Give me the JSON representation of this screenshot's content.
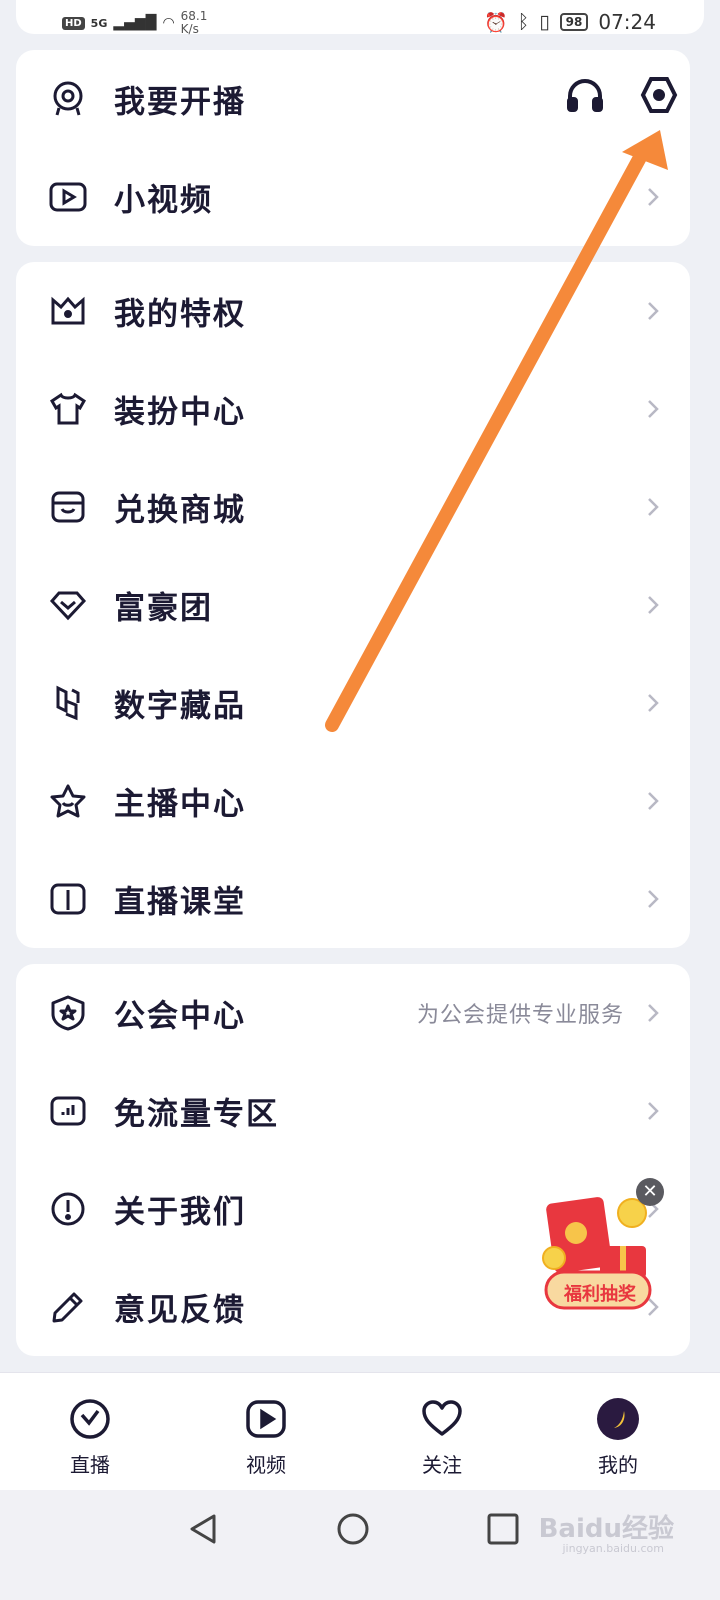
{
  "status_bar": {
    "hd": "HD",
    "network": "5G",
    "speed_value": "68.1",
    "speed_unit": "K/s",
    "battery": "98",
    "time": "07:24"
  },
  "section1": {
    "items": [
      {
        "label": "我要开播",
        "icon": "webcam-icon"
      },
      {
        "label": "小视频",
        "icon": "play-box-icon"
      }
    ],
    "header_icons": [
      "headphones-icon",
      "settings-hex-icon"
    ]
  },
  "section2": {
    "items": [
      {
        "label": "我的特权",
        "icon": "crown-icon"
      },
      {
        "label": "装扮中心",
        "icon": "tshirt-icon"
      },
      {
        "label": "兑换商城",
        "icon": "store-icon"
      },
      {
        "label": "富豪团",
        "icon": "diamond-icon"
      },
      {
        "label": "数字藏品",
        "icon": "collectible-icon"
      },
      {
        "label": "主播中心",
        "icon": "star-icon"
      },
      {
        "label": "直播课堂",
        "icon": "book-icon"
      }
    ]
  },
  "section3": {
    "items": [
      {
        "label": "公会中心",
        "sub": "为公会提供专业服务",
        "icon": "shield-icon"
      },
      {
        "label": "免流量专区",
        "icon": "chart-box-icon"
      },
      {
        "label": "关于我们",
        "icon": "info-icon"
      },
      {
        "label": "意见反馈",
        "icon": "pencil-icon"
      }
    ]
  },
  "promo": {
    "label": "福利抽奖"
  },
  "bottom_nav": [
    {
      "label": "直播",
      "icon": "live-icon"
    },
    {
      "label": "视频",
      "icon": "video-icon"
    },
    {
      "label": "关注",
      "icon": "heart-icon"
    },
    {
      "label": "我的",
      "icon": "avatar-icon"
    }
  ],
  "watermark": {
    "brand": "Baidu经验",
    "url": "jingyan.baidu.com"
  },
  "colors": {
    "accent_arrow": "#f5893a",
    "ink": "#1c1a33",
    "background": "#eef0f5",
    "card": "#ffffff"
  }
}
